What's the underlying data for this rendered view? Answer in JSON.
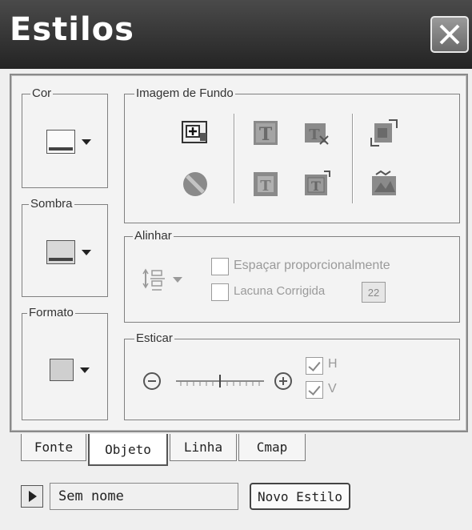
{
  "window": {
    "title": "Estilos",
    "close_icon": "close-x-icon"
  },
  "groups": {
    "cor": {
      "label": "Cor"
    },
    "sombra": {
      "label": "Sombra"
    },
    "formato": {
      "label": "Formato"
    },
    "imagem_fundo": {
      "label": "Imagem de Fundo"
    },
    "alinhar": {
      "label": "Alinhar",
      "proportional_label": "Espaçar proporcionalmente",
      "fixed_gap_label": "Lacuna Corrigida",
      "fixed_gap_value": "22"
    },
    "esticar": {
      "label": "Esticar",
      "h_label": "H",
      "v_label": "V",
      "h_checked": true,
      "v_checked": true
    }
  },
  "tabs": [
    {
      "label": "Fonte",
      "active": false
    },
    {
      "label": "Objeto",
      "active": true
    },
    {
      "label": "Linha",
      "active": false
    },
    {
      "label": "Cmap",
      "active": false
    }
  ],
  "bottom": {
    "style_name": "Sem nome",
    "new_style_label": "Novo Estilo"
  },
  "colors": {
    "titlebar": "#2f2f2f",
    "panel": "#f3f3f3",
    "disabled_text": "#9a9a9a"
  }
}
